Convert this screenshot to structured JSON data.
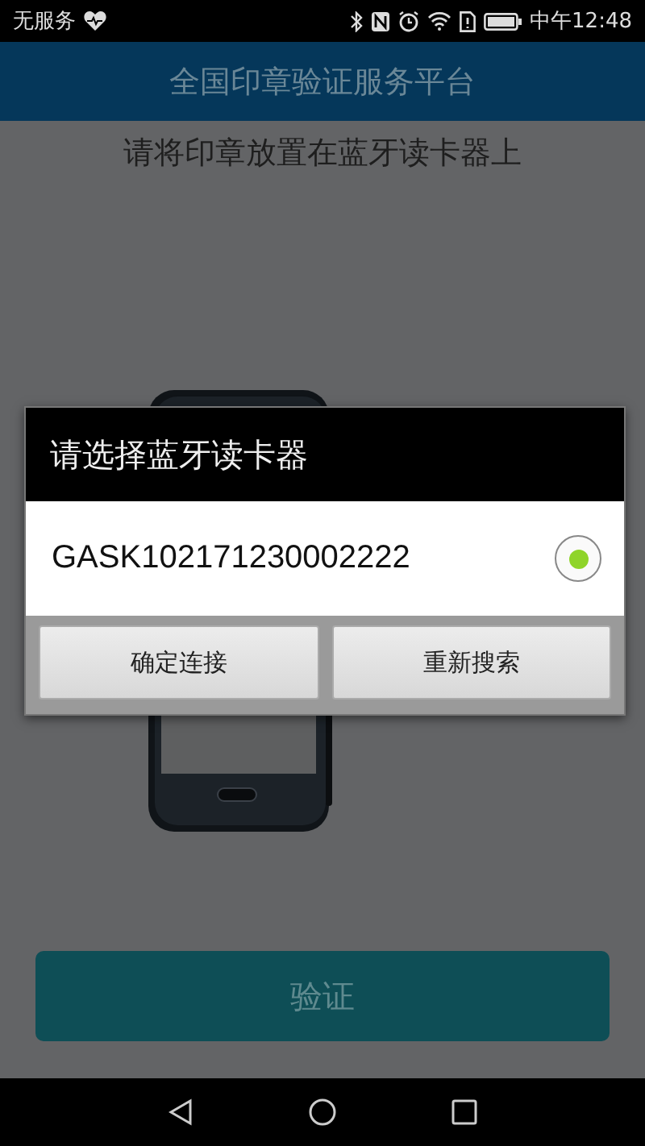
{
  "status_bar": {
    "carrier": "无服务",
    "time": "中午12:48"
  },
  "header": {
    "title": "全国印章验证服务平台"
  },
  "instruction": "请将印章放置在蓝牙读卡器上",
  "dialog": {
    "title": "请选择蓝牙读卡器",
    "devices": [
      {
        "label": "GASK102171230002222",
        "selected": true
      }
    ],
    "buttons": [
      "确定连接",
      "重新搜索"
    ]
  },
  "verify_button": "验证"
}
